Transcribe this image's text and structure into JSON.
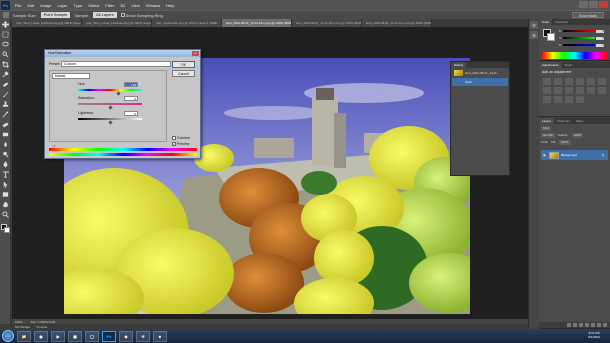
{
  "app": {
    "logo": "Ps",
    "menu": [
      "File",
      "Edit",
      "Image",
      "Layer",
      "Type",
      "Select",
      "Filter",
      "3D",
      "View",
      "Window",
      "Help"
    ]
  },
  "options": {
    "sample_size_label": "Sample Size:",
    "sample_size_value": "Point Sample",
    "sample_label": "Sample:",
    "sample_value": "All Layers",
    "show_ring_label": "Show Sampling Ring",
    "workspace": "Essentials"
  },
  "tabs": [
    "rpsc_Wort_Lunas_Ferdinand.jpg @ 100% (Layer 1, RGB/...",
    "rpsc_Wort_Lunas_Ferdinand.jpg @ 100% (Layer 1, RGB/...",
    "rpsc_screenshot.png @ 100% (Layer 0, RGB/...",
    "shot_2012-08-01_14-11-44-1.png @ 100% (RGB/8)...",
    "shot_2012-08-01_14-11-45-1.png @ 100% (RGB/8)...",
    "shot_2012-08-01_14-11-44-1.png @ 100% (RGB/8)..."
  ],
  "status": {
    "zoom": "100%",
    "doc": "Doc: 2.64M/2.64M",
    "minibridge": "Mini Bridge",
    "timeline": "Timeline"
  },
  "history": {
    "items": [
      {
        "label": "shot_2012-08-01_14-11...",
        "active": false
      },
      {
        "label": "Open",
        "active": true
      }
    ]
  },
  "color_panel": {
    "tabs": [
      "Color",
      "Swatches"
    ],
    "channels": [
      {
        "name": "R",
        "value": "0",
        "gradient": "linear-gradient(to right, #000, #f00)"
      },
      {
        "name": "G",
        "value": "0",
        "gradient": "linear-gradient(to right, #000, #0f0)"
      },
      {
        "name": "B",
        "value": "0",
        "gradient": "linear-gradient(to right, #000, #00f)"
      }
    ]
  },
  "adjustments_panel": {
    "tabs": [
      "Adjustments",
      "Styles"
    ],
    "title": "Add an adjustment"
  },
  "layers_panel": {
    "tabs": [
      "Layers",
      "Channels",
      "Paths"
    ],
    "kind": "Kind",
    "blend": "Normal",
    "opacity_label": "Opacity:",
    "opacity": "100%",
    "lock_label": "Lock:",
    "fill_label": "Fill:",
    "fill": "100%",
    "layer_name": "Background"
  },
  "huesat": {
    "title": "Hue/Saturation",
    "close": "x",
    "preset_label": "Preset:",
    "preset_value": "Custom",
    "ok": "OK",
    "cancel": "Cancel",
    "channel": "Master",
    "hue_label": "Hue:",
    "hue_value": "+13",
    "saturation_label": "Saturation:",
    "saturation_value": "0",
    "lightness_label": "Lightness:",
    "lightness_value": "0",
    "colorize_label": "Colorize",
    "preview_label": "Preview",
    "preview_checked": true,
    "colorize_checked": false
  },
  "taskbar": {
    "time": "8:21 PM",
    "date": "8/1/2012"
  }
}
